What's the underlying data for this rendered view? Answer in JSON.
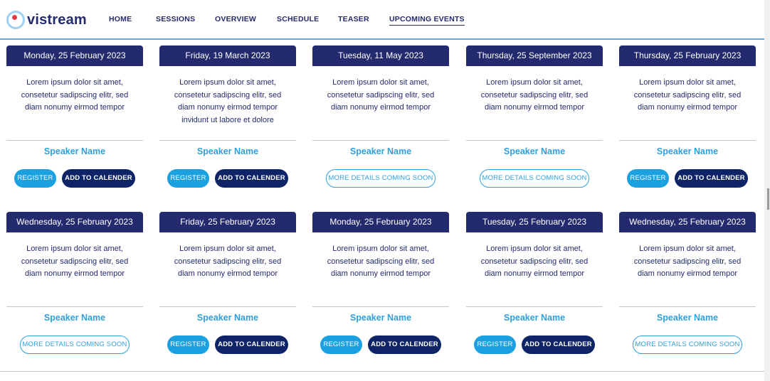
{
  "brand": {
    "name": "vistream",
    "ring_color": "#9fd2f2",
    "dot_color": "#e63946",
    "text_color": "#232a6e"
  },
  "colors": {
    "accent": "#1ba0e0",
    "dark": "#232a6e",
    "calendar": "#0e2466",
    "speaker": "#2f9fdc",
    "header_rule": "#5aa9df"
  },
  "nav": [
    {
      "label": "HOME",
      "active": false
    },
    {
      "label": "SESSIONS",
      "active": false
    },
    {
      "label": "OVERVIEW",
      "active": false
    },
    {
      "label": "SCHEDULE",
      "active": false
    },
    {
      "label": "TEASER",
      "active": false
    },
    {
      "label": "UPCOMING EVENTS",
      "active": true
    }
  ],
  "labels": {
    "register": "REGISTER",
    "calendar": "ADD TO CALENDER",
    "details": "MORE DETAILS COMING SOON"
  },
  "events": [
    {
      "date": "Monday, 25 February 2023",
      "description": "Lorem ipsum dolor sit amet, consetetur sadipscing elitr, sed diam nonumy eirmod tempor",
      "speaker": "Speaker Name",
      "status": "open"
    },
    {
      "date": "Friday, 19 March 2023",
      "description": "Lorem ipsum dolor sit amet, consetetur sadipscing elitr, sed diam nonumy eirmod tempor invidunt ut labore et dolore",
      "speaker": "Speaker Name",
      "status": "open"
    },
    {
      "date": "Tuesday, 11 May 2023",
      "description": "Lorem ipsum dolor sit amet, consetetur sadipscing elitr, sed diam nonumy eirmod tempor",
      "speaker": "Speaker Name",
      "status": "coming_soon"
    },
    {
      "date": "Thursday, 25 September 2023",
      "description": "Lorem ipsum dolor sit amet, consetetur sadipscing elitr, sed diam nonumy eirmod tempor",
      "speaker": "Speaker Name",
      "status": "coming_soon"
    },
    {
      "date": "Thursday, 25 February 2023",
      "description": "Lorem ipsum dolor sit amet, consetetur sadipscing elitr, sed diam nonumy eirmod tempor",
      "speaker": "Speaker Name",
      "status": "open"
    },
    {
      "date": "Wednesday, 25 February 2023",
      "description": "Lorem ipsum dolor sit amet, consetetur sadipscing elitr, sed diam nonumy eirmod tempor",
      "speaker": "Speaker Name",
      "status": "coming_soon"
    },
    {
      "date": "Friday, 25 February 2023",
      "description": "Lorem ipsum dolor sit amet, consetetur sadipscing elitr, sed diam nonumy eirmod tempor",
      "speaker": "Speaker Name",
      "status": "open"
    },
    {
      "date": "Monday, 25 February 2023",
      "description": "Lorem ipsum dolor sit amet, consetetur sadipscing elitr, sed diam nonumy eirmod tempor",
      "speaker": "Speaker Name",
      "status": "open"
    },
    {
      "date": "Tuesday, 25 February 2023",
      "description": "Lorem ipsum dolor sit amet, consetetur sadipscing elitr, sed diam nonumy eirmod tempor",
      "speaker": "Speaker Name",
      "status": "open"
    },
    {
      "date": "Wednesday, 25 February 2023",
      "description": "Lorem ipsum dolor sit amet, consetetur sadipscing elitr, sed diam nonumy eirmod tempor",
      "speaker": "Speaker Name",
      "status": "coming_soon"
    }
  ]
}
